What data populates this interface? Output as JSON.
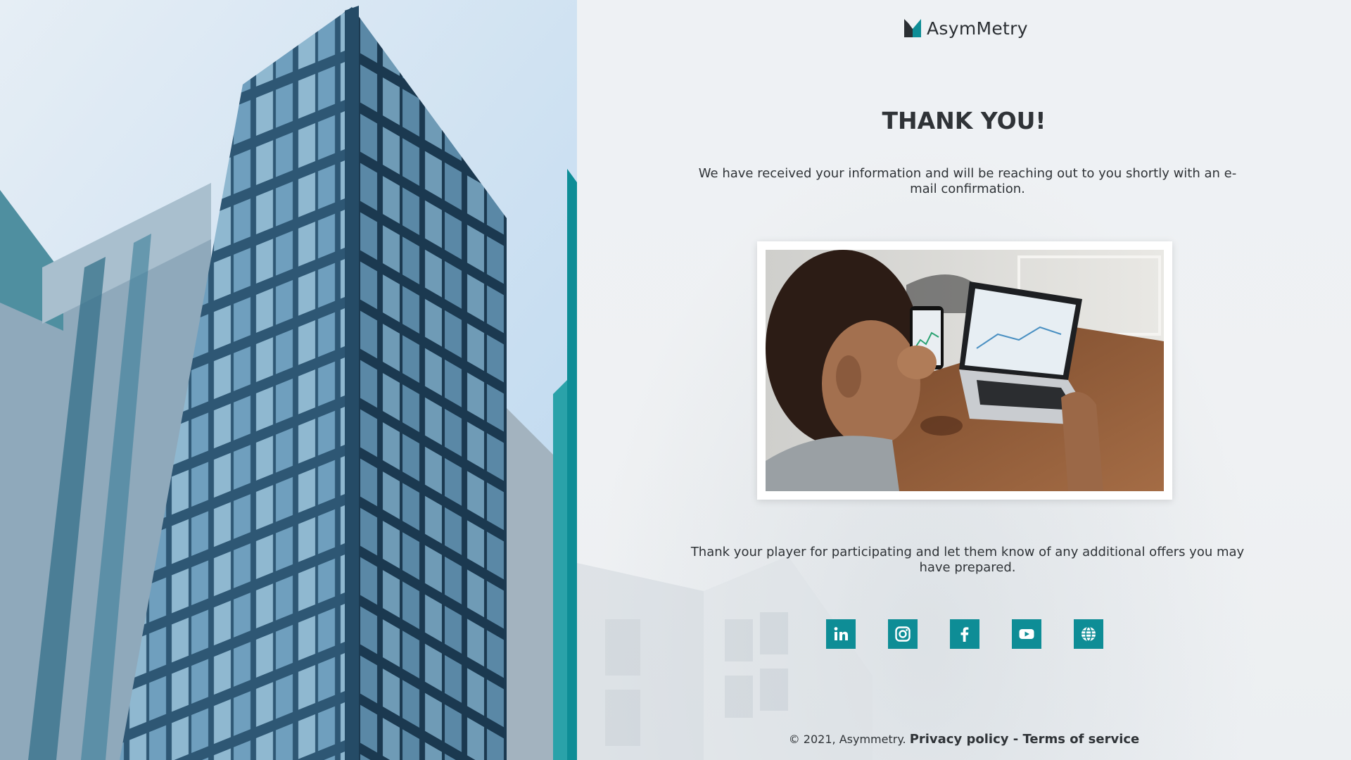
{
  "brand": {
    "name": "AsymMetry",
    "mark_color_dark": "#2b2f33",
    "mark_color_accent": "#0e8d96"
  },
  "page": {
    "title": "THANK YOU!",
    "intro": "We have received your information and will be reaching out to you shortly with an e-mail confirmation.",
    "outro": "Thank your player for participating and let them know of any additional offers you may have prepared."
  },
  "social": [
    {
      "name": "linkedin-icon",
      "label": "in"
    },
    {
      "name": "instagram-icon",
      "label": ""
    },
    {
      "name": "facebook-icon",
      "label": "f"
    },
    {
      "name": "youtube-icon",
      "label": ""
    },
    {
      "name": "globe-icon",
      "label": ""
    }
  ],
  "footer": {
    "copyright": "© 2021, Asymmetry.",
    "privacy": "Privacy policy",
    "separator": " - ",
    "terms": "Terms of service"
  },
  "colors": {
    "accent": "#0e8d96",
    "text": "#2f3337",
    "background": "#eef1f4"
  }
}
